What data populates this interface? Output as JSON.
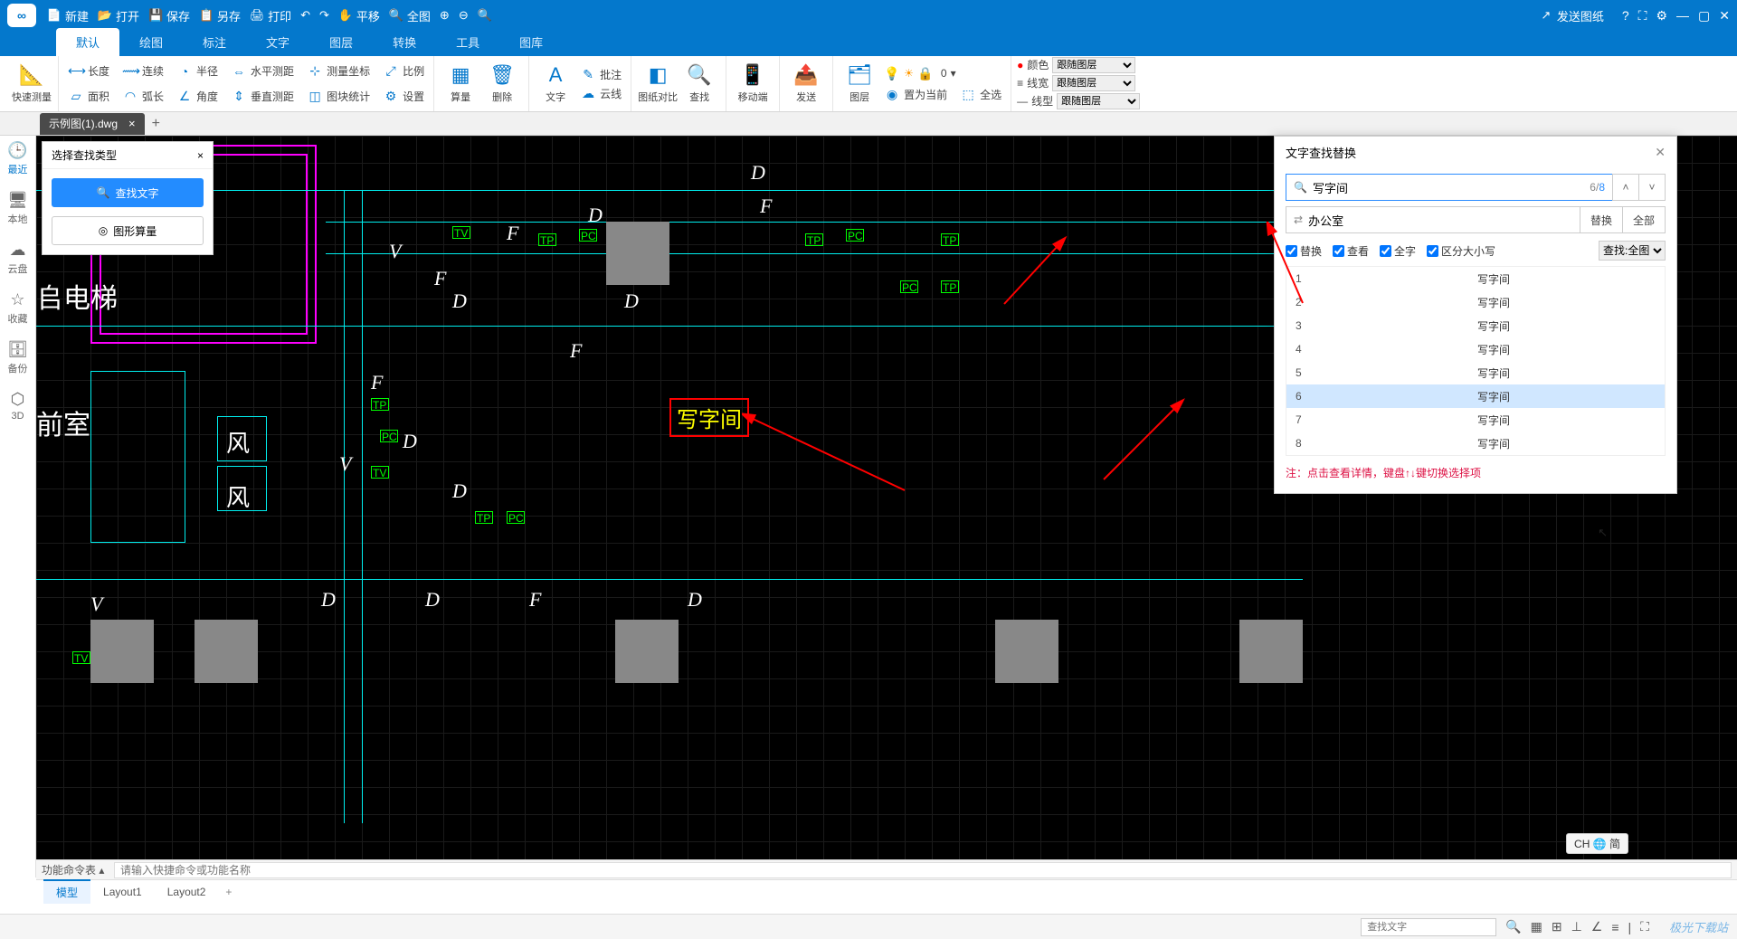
{
  "titlebar": {
    "items": [
      {
        "label": "新建"
      },
      {
        "label": "打开"
      },
      {
        "label": "保存"
      },
      {
        "label": "另存"
      },
      {
        "label": "打印"
      }
    ],
    "nav": [
      "↶",
      "↷"
    ],
    "view": [
      {
        "label": "平移"
      },
      {
        "label": "全图"
      }
    ],
    "zoom": [
      "⊕",
      "⊖",
      "🔍"
    ],
    "send": "发送图纸",
    "win": [
      "?",
      "⛶",
      "⚙",
      "—",
      "▢",
      "✕"
    ]
  },
  "menutabs": [
    "默认",
    "绘图",
    "标注",
    "文字",
    "图层",
    "转换",
    "工具",
    "图库"
  ],
  "ribbon": {
    "quick_measure": "快速测量",
    "measure_grid": [
      {
        "label": "长度"
      },
      {
        "label": "连续"
      },
      {
        "label": "半径"
      },
      {
        "label": "水平测距"
      },
      {
        "label": "测量坐标"
      },
      {
        "label": "比例"
      },
      {
        "label": "面积"
      },
      {
        "label": "弧长"
      },
      {
        "label": "角度"
      },
      {
        "label": "垂直测距"
      },
      {
        "label": "图块统计"
      },
      {
        "label": "设置"
      }
    ],
    "calc": "算量",
    "del": "删除",
    "text": "文字",
    "annot": "批注",
    "cloud": "云线",
    "compare": "图纸对比",
    "find": "查找",
    "move": "移动端",
    "send": "发送",
    "layer": "图层",
    "layer_mini": [
      {
        "label": "置为当前"
      },
      {
        "label": "全选"
      }
    ],
    "layer_top": "0",
    "props": [
      {
        "label": "颜色",
        "value": "跟随图层"
      },
      {
        "label": "线宽",
        "value": "跟随图层"
      },
      {
        "label": "线型",
        "value": "跟随图层"
      }
    ]
  },
  "doctab": {
    "name": "示例图(1).dwg"
  },
  "sidebar": [
    {
      "label": "最近"
    },
    {
      "label": "本地"
    },
    {
      "label": "云盘"
    },
    {
      "label": "收藏"
    },
    {
      "label": "备份"
    },
    {
      "label": "3D"
    }
  ],
  "search_type": {
    "title": "选择查找类型",
    "btn1": "查找文字",
    "btn2": "图形算量"
  },
  "find_panel": {
    "title": "文字查找替换",
    "search_value": "写字间",
    "count": "6",
    "total": "8",
    "replace_value": "办公室",
    "btn_replace": "替换",
    "btn_all": "全部",
    "opt_replace": "替换",
    "opt_view": "查看",
    "opt_whole": "全字",
    "opt_case": "区分大小写",
    "scope_label": "查找:全图",
    "results": [
      {
        "n": "1",
        "t": "写字间"
      },
      {
        "n": "2",
        "t": "写字间"
      },
      {
        "n": "3",
        "t": "写字间"
      },
      {
        "n": "4",
        "t": "写字间"
      },
      {
        "n": "5",
        "t": "写字间"
      },
      {
        "n": "6",
        "t": "写字间"
      },
      {
        "n": "7",
        "t": "写字间"
      },
      {
        "n": "8",
        "t": "写字间"
      }
    ],
    "hint": "注：点击查看详情，键盘↑↓键切换选择项"
  },
  "canvas": {
    "highlight": "写字间",
    "elevator": "𠂤电梯",
    "front_room": "前室",
    "wind": "风",
    "ime": "CH 🌐 简",
    "letters": {
      "D": "D",
      "F": "F",
      "V": "V",
      "TP": "TP",
      "PC": "PC",
      "TV": "TV"
    }
  },
  "cmdbar": {
    "label": "功能命令表 ▴",
    "placeholder": "请输入快捷命令或功能名称"
  },
  "layouts": [
    "模型",
    "Layout1",
    "Layout2"
  ],
  "statusbar": {
    "search_placeholder": "查找文字",
    "brand": "极光下载站"
  }
}
